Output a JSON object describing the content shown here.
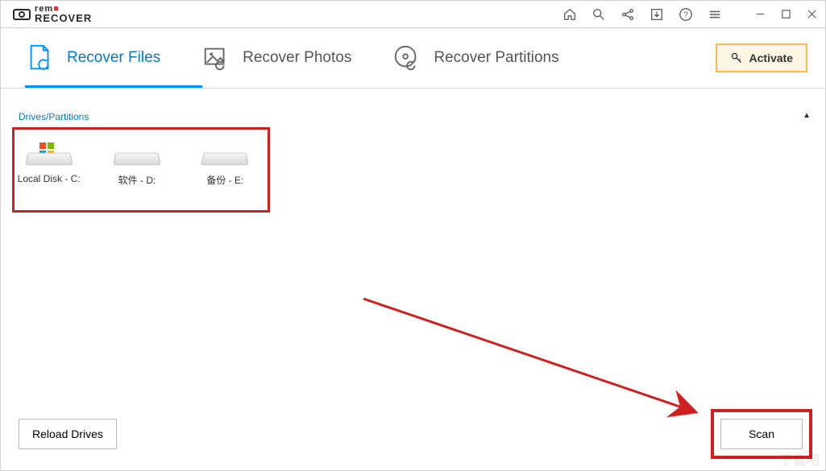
{
  "brand": {
    "line1": "rem",
    "line2": "RECOVER"
  },
  "titlebar": {
    "icons": [
      "home-icon",
      "search-icon",
      "share-icon",
      "import-icon",
      "help-icon",
      "menu-icon"
    ]
  },
  "tabs": [
    {
      "label": "Recover Files",
      "icon": "file-refresh-icon",
      "active": true
    },
    {
      "label": "Recover Photos",
      "icon": "photo-refresh-icon",
      "active": false
    },
    {
      "label": "Recover Partitions",
      "icon": "disk-refresh-icon",
      "active": false
    }
  ],
  "activate_label": "Activate",
  "section_title": "Drives/Partitions",
  "drives": [
    {
      "label": "Local Disk - C:",
      "badge": "windows"
    },
    {
      "label": "软件 - D:",
      "badge": ""
    },
    {
      "label": "备份 - E:",
      "badge": ""
    }
  ],
  "buttons": {
    "reload": "Reload Drives",
    "scan": "Scan"
  },
  "annotation": {
    "highlight_color": "#d01f1f"
  },
  "watermark_text": "下载吧"
}
